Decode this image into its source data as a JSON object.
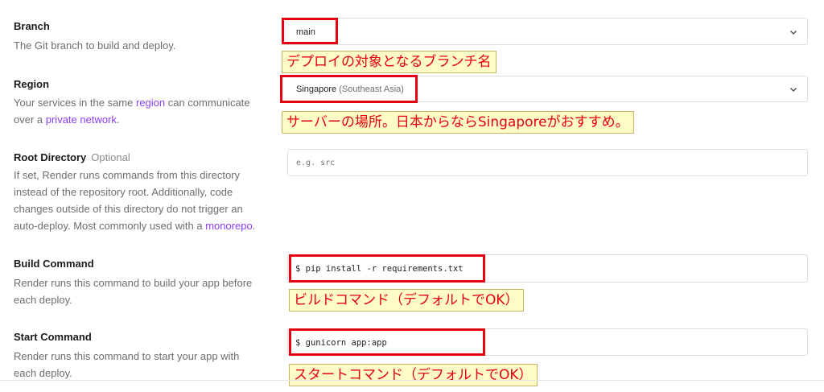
{
  "branch": {
    "label": "Branch",
    "description": "The Git branch to build and deploy.",
    "value": "main",
    "note": "デプロイの対象となるブランチ名"
  },
  "region": {
    "label": "Region",
    "desc_prefix": "Your services in the same ",
    "desc_link1": "region",
    "desc_middle": " can communicate over a ",
    "desc_link2": "private network",
    "desc_suffix": ".",
    "value": "Singapore",
    "value_sub": " (Southeast Asia)",
    "note": "サーバーの場所。日本からならSingaporeがおすすめ。"
  },
  "root_directory": {
    "label": "Root Directory",
    "optional": "Optional",
    "desc_prefix": "If set, Render runs commands from this directory instead of the repository root. Additionally, code changes outside of this directory do not trigger an auto-deploy. Most commonly used with a ",
    "desc_link": "monorepo",
    "desc_suffix": ".",
    "placeholder": "e.g. src"
  },
  "build_command": {
    "label": "Build Command",
    "description": "Render runs this command to build your app before each deploy.",
    "value": "$ pip install -r requirements.txt",
    "note": "ビルドコマンド（デフォルトでOK）"
  },
  "start_command": {
    "label": "Start Command",
    "description": "Render runs this command to start your app with each deploy.",
    "value": "$ gunicorn app:app",
    "note": "スタートコマンド（デフォルトでOK）"
  },
  "icons": {
    "select_chevron": "chevron-down-icon"
  },
  "colors": {
    "link": "#8a3ffc",
    "annotation_red": "#e60012",
    "annotation_bg": "#fffbc4"
  }
}
